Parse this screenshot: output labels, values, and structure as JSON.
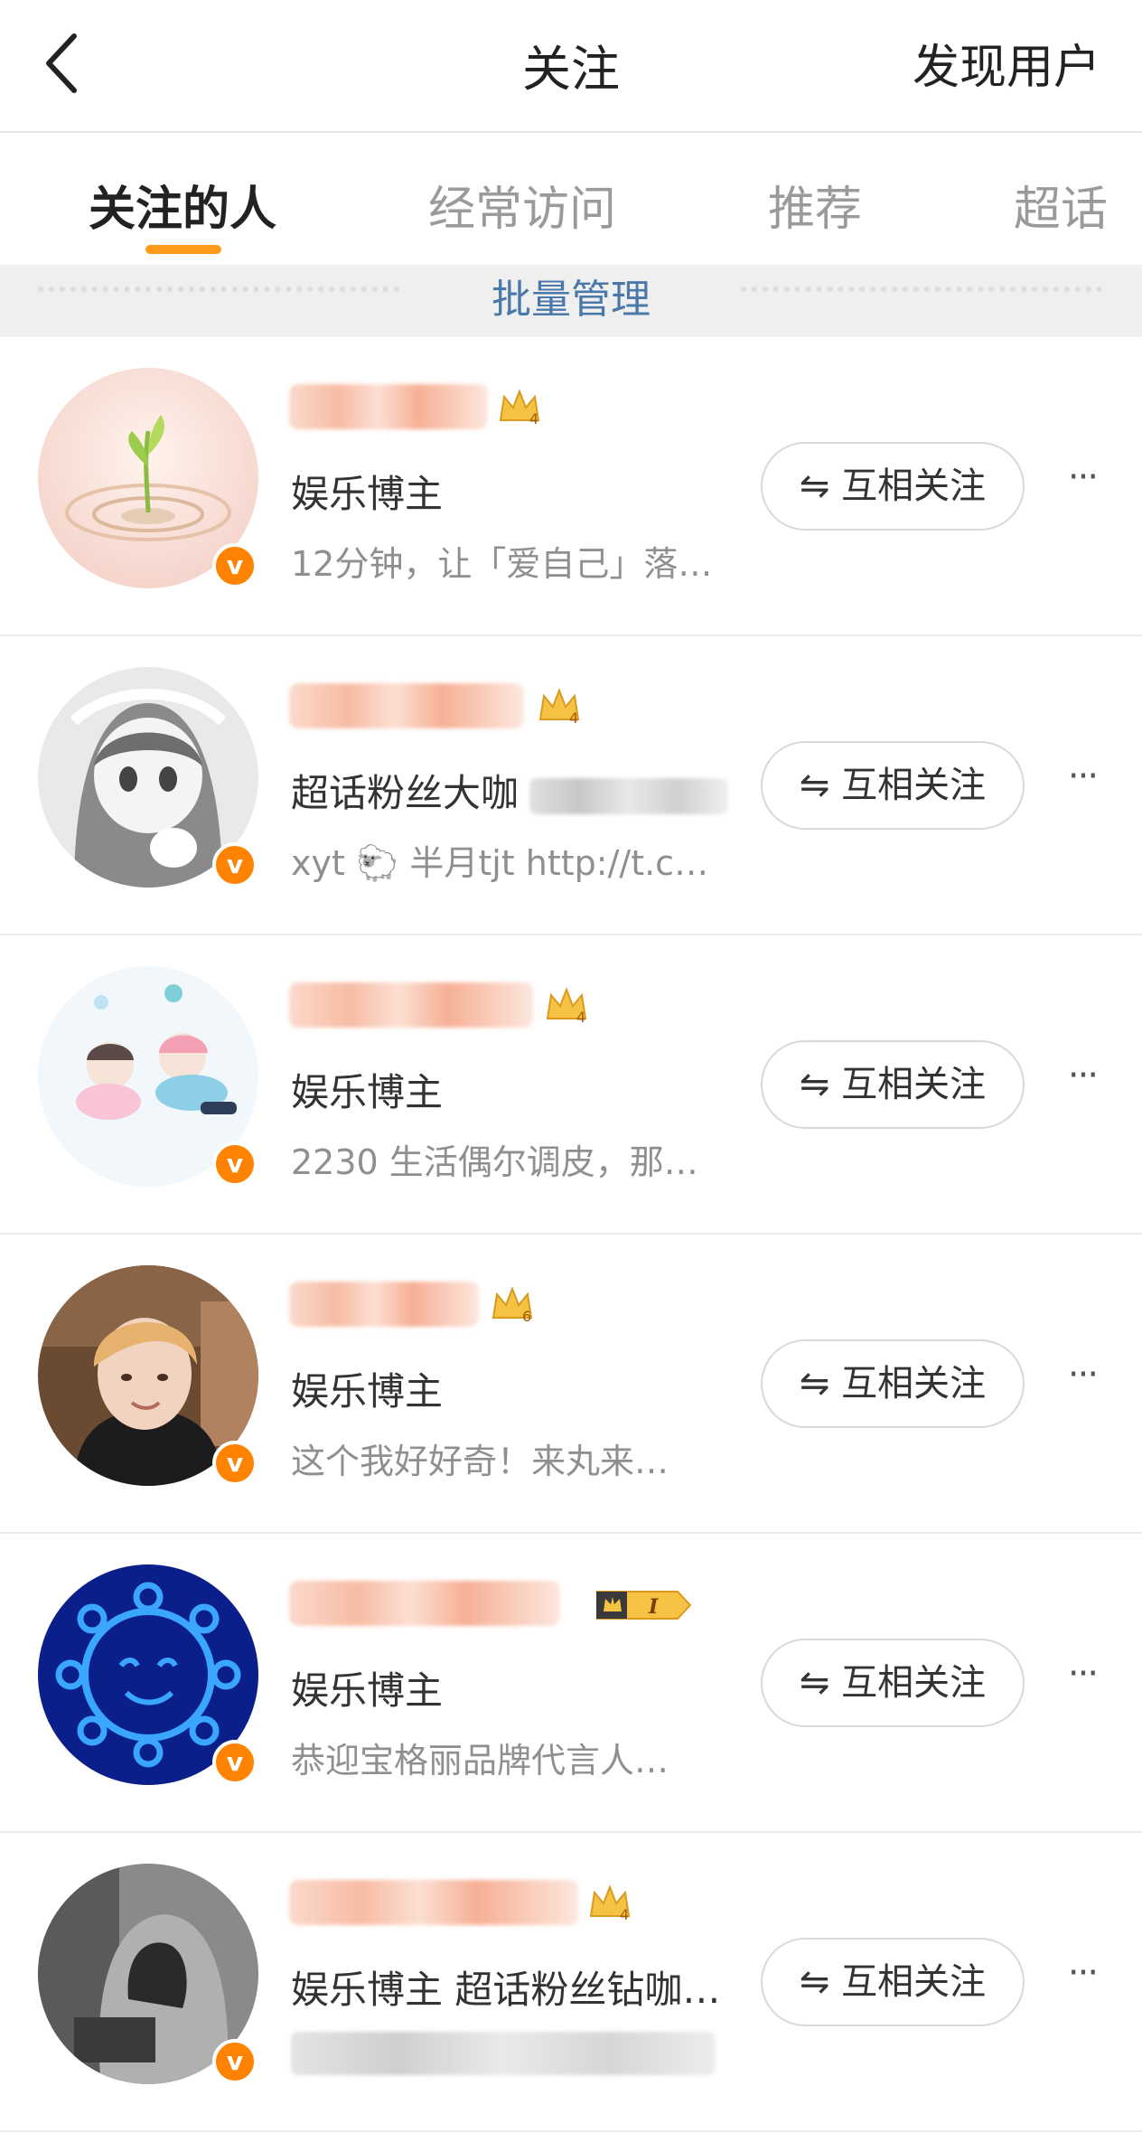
{
  "header": {
    "title": "关注",
    "discover_label": "发现用户"
  },
  "tabs": [
    {
      "label": "关注的人",
      "active": true
    },
    {
      "label": "经常访问",
      "active": false
    },
    {
      "label": "推荐",
      "active": false
    },
    {
      "label": "超话",
      "active": false
    }
  ],
  "batch": {
    "label": "批量管理"
  },
  "accent_color": "#ff9a1a",
  "verified_color": "#ff8200",
  "verified_glyph": "v",
  "follow_label": "⇋ 互相关注",
  "more_glyph": "···",
  "users": [
    {
      "role": "娱乐博主",
      "desc": "12分钟，让「爱自己」落…",
      "crown_level": "4",
      "avatar": "sprout-avatar"
    },
    {
      "role": "超话粉丝大咖",
      "desc": "xyt 🐑 半月tjt  http://t.c…",
      "crown_level": "4",
      "avatar": "anime-girl-avatar"
    },
    {
      "role": "娱乐博主",
      "desc": "2230 生活偶尔调皮，那…",
      "crown_level": "4",
      "avatar": "cartoon-couple-avatar"
    },
    {
      "role": "娱乐博主",
      "desc": "这个我好好奇！来丸来…",
      "crown_level": "6",
      "avatar": "photo-portrait-avatar"
    },
    {
      "role": "娱乐博主",
      "desc": "恭迎宝格丽品牌代言人…",
      "crown_level": "I",
      "avatar": "neon-sun-avatar"
    },
    {
      "role": "娱乐博主 超话粉丝钻咖…",
      "desc": "",
      "crown_level": "4",
      "avatar": "hooded-portrait-avatar"
    }
  ]
}
